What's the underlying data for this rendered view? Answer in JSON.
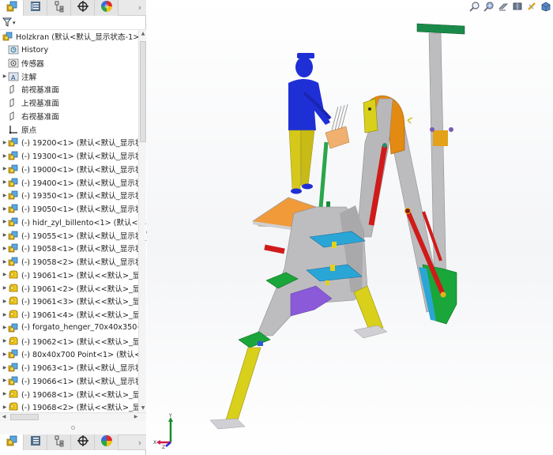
{
  "panel": {
    "tabs": [
      {
        "name": "featuremanager-tab",
        "icon": "feature-manager-icon",
        "active": true
      },
      {
        "name": "propertymanager-tab",
        "icon": "property-manager-icon",
        "active": false
      },
      {
        "name": "configurationmanager-tab",
        "icon": "configuration-manager-icon",
        "active": false
      },
      {
        "name": "dimxpertmanager-tab",
        "icon": "dimxpert-crosshair-icon",
        "active": false
      },
      {
        "name": "displaymanager-tab",
        "icon": "display-manager-icon",
        "active": false
      }
    ],
    "more_label": "›",
    "filter_caret": "▾",
    "tree": {
      "root": {
        "label": "Holzkran  (默认<默认_显示状态-1>)",
        "icon": "assembly-icon"
      },
      "items": [
        {
          "label": "History",
          "icon": "history-folder-icon",
          "expandable": false
        },
        {
          "label": "传感器",
          "icon": "sensors-folder-icon",
          "expandable": false
        },
        {
          "label": "注解",
          "icon": "annotations-folder-icon",
          "expandable": true
        },
        {
          "label": "前视基准面",
          "icon": "plane-icon",
          "expandable": false
        },
        {
          "label": "上视基准面",
          "icon": "plane-icon",
          "expandable": false
        },
        {
          "label": "右视基准面",
          "icon": "plane-icon",
          "expandable": false
        },
        {
          "label": "原点",
          "icon": "origin-icon",
          "expandable": false
        },
        {
          "label": "(-) 19200<1> (默认<默认_显示状",
          "icon": "subassembly-icon",
          "expandable": true
        },
        {
          "label": "(-) 19300<1> (默认<默认_显示状",
          "icon": "subassembly-icon",
          "expandable": true
        },
        {
          "label": "(-) 19000<1> (默认<默认_显示状",
          "icon": "subassembly-icon",
          "expandable": true
        },
        {
          "label": "(-) 19400<1> (默认<默认_显示状",
          "icon": "subassembly-icon",
          "expandable": true
        },
        {
          "label": "(-) 19350<1> (默认<默认_显示状",
          "icon": "subassembly-icon",
          "expandable": true
        },
        {
          "label": "(-) 19050<1> (默认<默认_显示状",
          "icon": "subassembly-icon",
          "expandable": true
        },
        {
          "label": "(-) hidr_zyl_billento<1> (默认<默",
          "icon": "subassembly-icon",
          "expandable": true
        },
        {
          "label": "(-) 19055<1> (默认<默认_显示状",
          "icon": "subassembly-icon",
          "expandable": true
        },
        {
          "label": "(-) 19058<1> (默认<默认_显示状",
          "icon": "subassembly-icon",
          "expandable": true
        },
        {
          "label": "(-) 19058<2> (默认<默认_显示状",
          "icon": "subassembly-icon",
          "expandable": true
        },
        {
          "label": "(-) 19061<1> (默认<<默认>_显",
          "icon": "part-icon",
          "expandable": true
        },
        {
          "label": "(-) 19061<2> (默认<<默认>_显",
          "icon": "part-icon",
          "expandable": true
        },
        {
          "label": "(-) 19061<3> (默认<<默认>_显",
          "icon": "part-icon",
          "expandable": true
        },
        {
          "label": "(-) 19061<4> (默认<<默认>_显",
          "icon": "part-icon",
          "expandable": true
        },
        {
          "label": "(-) forgato_henger_70x40x350<",
          "icon": "subassembly-icon",
          "expandable": true
        },
        {
          "label": "(-) 19062<1> (默认<<默认>_显",
          "icon": "part-icon",
          "expandable": true
        },
        {
          "label": "(-) 80x40x700 Point<1> (默认<",
          "icon": "subassembly-icon",
          "expandable": true
        },
        {
          "label": "(-) 19063<1> (默认<默认_显示状",
          "icon": "subassembly-icon",
          "expandable": true
        },
        {
          "label": "(-) 19066<1> (默认<默认_显示状",
          "icon": "subassembly-icon",
          "expandable": true
        },
        {
          "label": "(-) 19068<1> (默认<<默认>_显",
          "icon": "part-icon",
          "expandable": true
        },
        {
          "label": "(-) 19068<2> (默认<<默认>_显",
          "icon": "part-icon",
          "expandable": true
        }
      ]
    },
    "scroll": {
      "up": "▲",
      "down": "▼",
      "left": "◀",
      "right": "▶",
      "grip": "≡"
    }
  },
  "viewport": {
    "hud_tools": [
      {
        "name": "zoom-to-fit-button",
        "icon": "zoom-to-fit-icon"
      },
      {
        "name": "zoom-to-area-button",
        "icon": "zoom-to-area-icon"
      },
      {
        "name": "previous-view-button",
        "icon": "previous-view-icon"
      },
      {
        "name": "section-view-button",
        "icon": "section-view-icon"
      },
      {
        "name": "view-orientation-button",
        "icon": "view-orientation-icon"
      },
      {
        "name": "display-style-button",
        "icon": "display-style-icon"
      }
    ],
    "model_name": "Holzkran",
    "triad": {
      "x": "X",
      "y": "Y",
      "z": "Z"
    },
    "colors": {
      "figure_blue": "#1f2fd6",
      "figure_legs": "#d6c81a",
      "frame_gray": "#b9b9bb",
      "boom_orange": "#e38a12",
      "cylinder_red": "#d11a1a",
      "clamp_cyan": "#2aa6d6",
      "plate_green": "#19a53a",
      "foot_yellow": "#d8d01a",
      "base_purple": "#8a5ad8",
      "grate_orange": "#f09a3a"
    }
  }
}
